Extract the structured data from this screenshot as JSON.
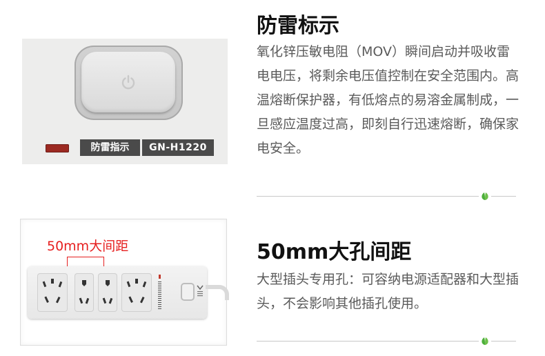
{
  "sections": [
    {
      "heading": "防雷标示",
      "description": "氧化锌压敏电阻（MOV）瞬间启动并吸收雷电电压，将剩余电压值控制在安全范围内。高温熔断保护器，有低熔点的易溶金属制成，一旦感应温度过高，即刻自行迅速熔断，确保家电安全。",
      "image_labels": {
        "indicator_text": "防雷指示",
        "model_text": "GN-H1220"
      }
    },
    {
      "heading": "50mm大孔间距",
      "description": "大型插头专用孔：可容纳电源适配器和大型插头，不会影响其他插孔使用。",
      "image_labels": {
        "spacing_text": "50mm大间距"
      }
    }
  ],
  "colors": {
    "accent_red": "#e61e1e",
    "leaf_green": "#4caf3a",
    "heading": "#111111",
    "body_text": "#5a5a5a"
  },
  "icons": [
    "power-icon",
    "leaf-icon",
    "socket-icon"
  ]
}
